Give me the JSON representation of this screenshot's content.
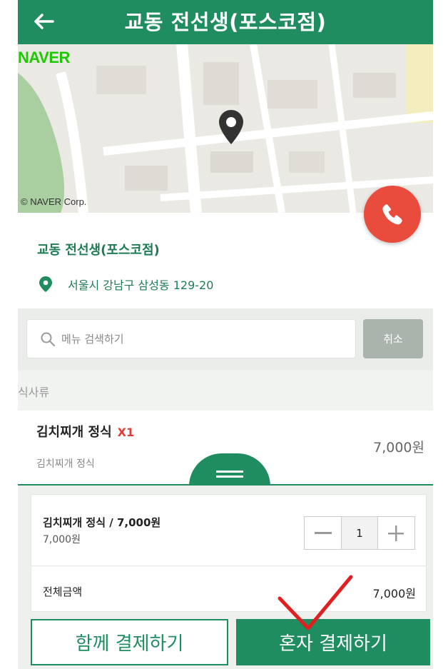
{
  "header": {
    "title": "교동 전선생(포스코점)"
  },
  "map": {
    "provider_logo": "NAVER",
    "copyright": "© NAVER Corp."
  },
  "store": {
    "name": "교동 전선생(포스코점)",
    "address": "서울시 강남구 삼성동 129-20"
  },
  "search": {
    "placeholder": "메뉴 검색하기",
    "cancel_label": "취소"
  },
  "category": {
    "label": "식사류"
  },
  "menu_items": [
    {
      "name": "김치찌개 정식",
      "qty": "X1",
      "subtitle": "김치찌개 정식",
      "price": "7,000원"
    }
  ],
  "order": {
    "item_line": "김치찌개 정식 / 7,000원",
    "item_price": "7,000원",
    "quantity": "1",
    "total_label": "전체금액",
    "total_value": "7,000원"
  },
  "buttons": {
    "pay_together": "함께 결제하기",
    "pay_alone": "혼자 결제하기"
  },
  "colors": {
    "primary_green": "#1f8d60",
    "call_red": "#e94b3c",
    "qty_red": "#e53935",
    "annotation_red": "#e02020"
  },
  "icons": [
    "back-arrow-icon",
    "map-pin-icon",
    "phone-icon",
    "location-pin-icon",
    "search-icon",
    "drag-handle-icon",
    "minus-icon",
    "plus-icon",
    "checkmark-annotation-icon"
  ]
}
